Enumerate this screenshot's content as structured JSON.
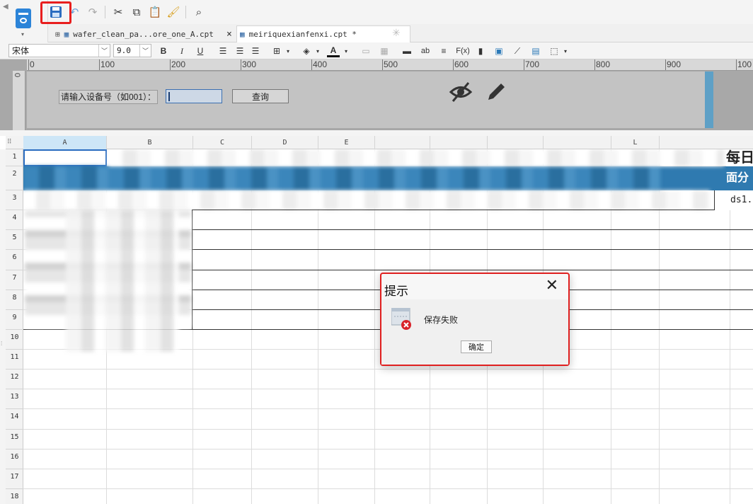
{
  "toolbar": {
    "icons": [
      "new-report-icon",
      "save-icon",
      "undo-icon",
      "redo-icon",
      "cut-icon",
      "copy-icon",
      "paste-icon",
      "format-painter-icon",
      "preview-icon"
    ]
  },
  "tabs": [
    {
      "label": "wafer_clean_pa...ore_one_A.cpt",
      "close": "×"
    },
    {
      "label": "meiriquexianfenxi.cpt *",
      "close": ""
    }
  ],
  "format": {
    "font_family": "宋体",
    "font_size": "9.0",
    "bold": "B",
    "italic": "I",
    "underline": "U",
    "text_color": "A",
    "ab": "ab",
    "fx": "F(x)"
  },
  "ruler": {
    "ticks": [
      "0",
      "100",
      "200",
      "300",
      "400",
      "500",
      "600",
      "700",
      "800",
      "900",
      "100"
    ]
  },
  "params": {
    "label": "请输入设备号（如001）：",
    "input_value": "",
    "query_button": "查询"
  },
  "columns": [
    "A",
    "B",
    "C",
    "D",
    "E",
    "",
    "",
    "",
    "",
    "L"
  ],
  "rows": [
    "1",
    "2",
    "3",
    "4",
    "5",
    "6",
    "7",
    "8",
    "9",
    "10",
    "11",
    "12",
    "13",
    "14",
    "15",
    "16",
    "17",
    "18"
  ],
  "cells": {
    "L1": "每日",
    "L2": "面分",
    "L3": "ds1."
  },
  "dialog": {
    "title": "提示",
    "close": "✕",
    "message": "保存失败",
    "ok": "确定"
  },
  "colors": {
    "accent": "#1e78c8",
    "error": "#e02020",
    "param_bg": "#c3c3c3",
    "banner": "#2f7ab0"
  }
}
